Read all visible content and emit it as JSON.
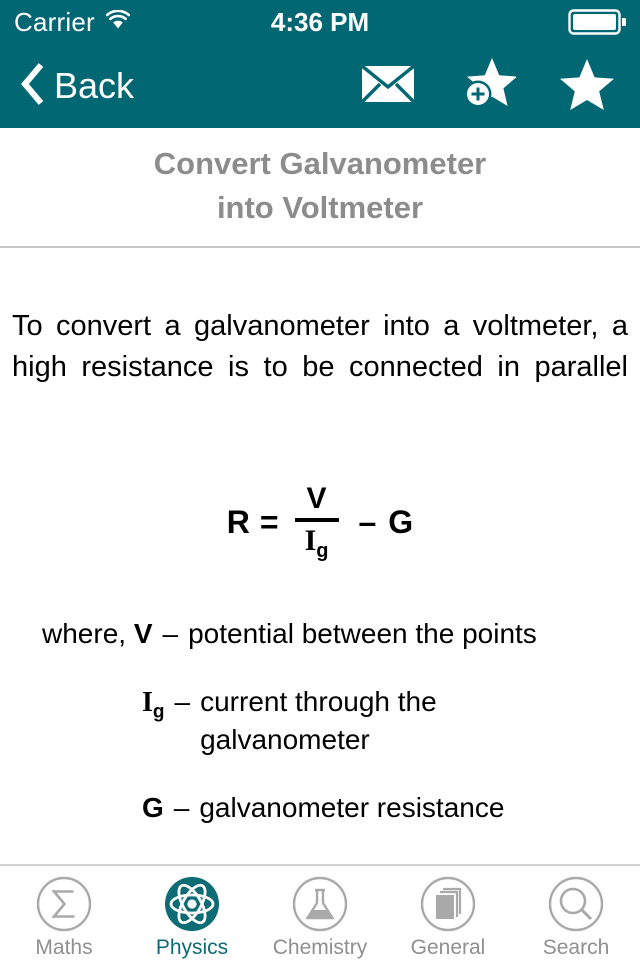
{
  "colors": {
    "brand_teal": "#006773",
    "title_gray": "#8c8c8c",
    "tab_inactive": "#8f8f8f",
    "tab_active": "#0d6b74",
    "divider": "#c6c6c6"
  },
  "status_bar": {
    "carrier": "Carrier",
    "wifi_icon": "wifi-icon",
    "time": "4:36 PM",
    "battery_icon": "battery-full-icon"
  },
  "nav_bar": {
    "back_label": "Back",
    "back_icon": "chevron-left-icon",
    "actions": [
      {
        "name": "envelope-icon",
        "label": "Email"
      },
      {
        "name": "star-plus-icon",
        "label": "Add to favourites"
      },
      {
        "name": "star-icon",
        "label": "Favourites"
      }
    ]
  },
  "page": {
    "title_line1": "Convert Galvanometer",
    "title_line2": "into Voltmeter",
    "body": "To convert a galvanometer into a voltmeter, a high resistance is to be connected in parallel"
  },
  "formula": {
    "result": "R",
    "equals": "=",
    "numerator": "V",
    "denominator": "I",
    "denominator_subscript": "g",
    "operator": "–",
    "operand": "G"
  },
  "definitions": {
    "lead": "where,",
    "items": [
      {
        "symbol": "V",
        "subscript": "",
        "dash": "–",
        "description": "potential between the points"
      },
      {
        "symbol": "I",
        "subscript": "g",
        "dash": "–",
        "description": "current through the galvanometer"
      },
      {
        "symbol": "G",
        "subscript": "",
        "dash": "–",
        "description": "galvanometer resistance"
      }
    ]
  },
  "tab_bar": {
    "tabs": [
      {
        "label": "Maths",
        "icon": "sigma-icon",
        "active": false
      },
      {
        "label": "Physics",
        "icon": "atom-icon",
        "active": true
      },
      {
        "label": "Chemistry",
        "icon": "flask-icon",
        "active": false
      },
      {
        "label": "General",
        "icon": "documents-icon",
        "active": false
      },
      {
        "label": "Search",
        "icon": "magnifier-icon",
        "active": false
      }
    ]
  }
}
